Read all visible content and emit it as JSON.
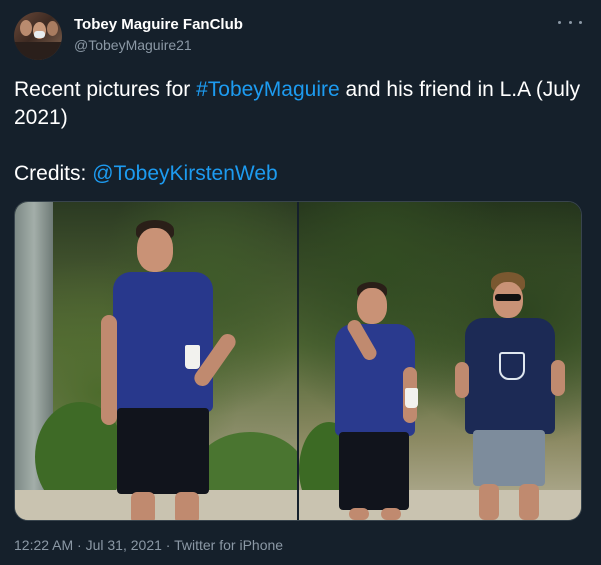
{
  "author": {
    "display_name": "Tobey Maguire FanClub",
    "handle": "@TobeyMaguire21",
    "avatar_icon": "fan-group-avatar"
  },
  "more_menu": {
    "icon": "more-horizontal-icon"
  },
  "tweet": {
    "text_prefix": "Recent pictures for ",
    "hashtag": "#TobeyMaguire",
    "text_suffix": " and his friend in L.A (July 2021)",
    "credits_label": "Credits: ",
    "credits_mention": "@TobeyKirstenWeb"
  },
  "media": [
    {
      "name": "photo-left",
      "description_icon": "photo-icon"
    },
    {
      "name": "photo-right",
      "description_icon": "photo-icon"
    }
  ],
  "meta": {
    "time": "12:22 AM",
    "separator": " · ",
    "date": "Jul 31, 2021",
    "source": "Twitter for iPhone"
  },
  "colors": {
    "background": "#15202b",
    "text": "#ffffff",
    "secondary": "#8b98a5",
    "link": "#1d9bf0"
  }
}
